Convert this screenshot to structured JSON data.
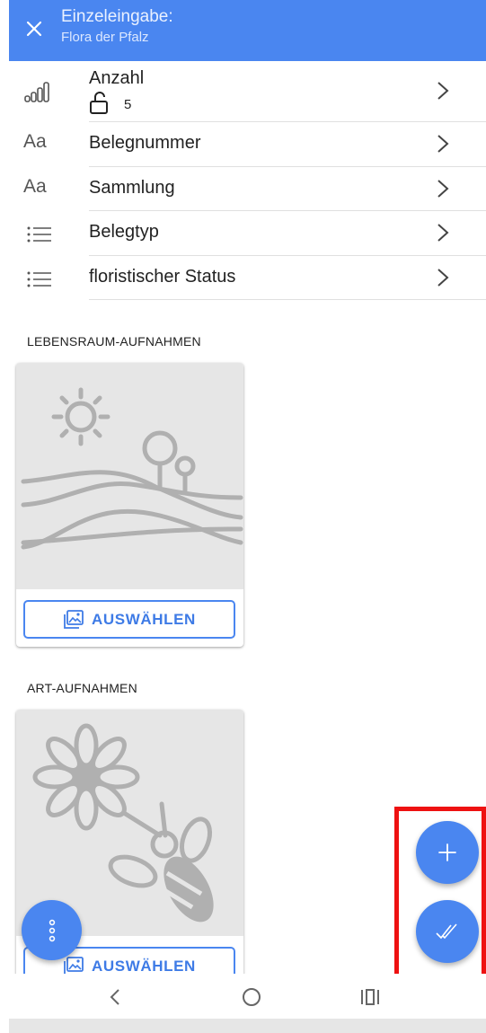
{
  "header": {
    "title": "Einzeleingabe:",
    "subtitle": "Flora der Pfalz",
    "close_icon": "close-icon"
  },
  "fields": [
    {
      "label": "Anzahl",
      "icon": "signal-bars-icon",
      "value": "5",
      "value_icon": "unlock-icon"
    },
    {
      "label": "Belegnummer",
      "icon": "text-aa-icon",
      "icon_text": "Aa"
    },
    {
      "label": "Sammlung",
      "icon": "text-aa-icon",
      "icon_text": "Aa"
    },
    {
      "label": "Belegtyp",
      "icon": "list-icon"
    },
    {
      "label": "floristischer Status",
      "icon": "list-icon"
    }
  ],
  "sections": [
    {
      "title": "LEBENSRAUM-AUFNAHMEN",
      "button_label": "AUSWÄHLEN",
      "placeholder": "landscape-placeholder"
    },
    {
      "title": "ART-AUFNAHMEN",
      "button_label": "AUSWÄHLEN",
      "placeholder": "flower-bee-placeholder"
    }
  ],
  "fabs": {
    "add": "plus-icon",
    "done": "double-check-icon",
    "menu": "more-vert-icon"
  },
  "colors": {
    "primary": "#4a86f0",
    "highlight": "#ee1111",
    "placeholder_bg": "#e6e6e6",
    "placeholder_art": "#b0b0b0"
  }
}
